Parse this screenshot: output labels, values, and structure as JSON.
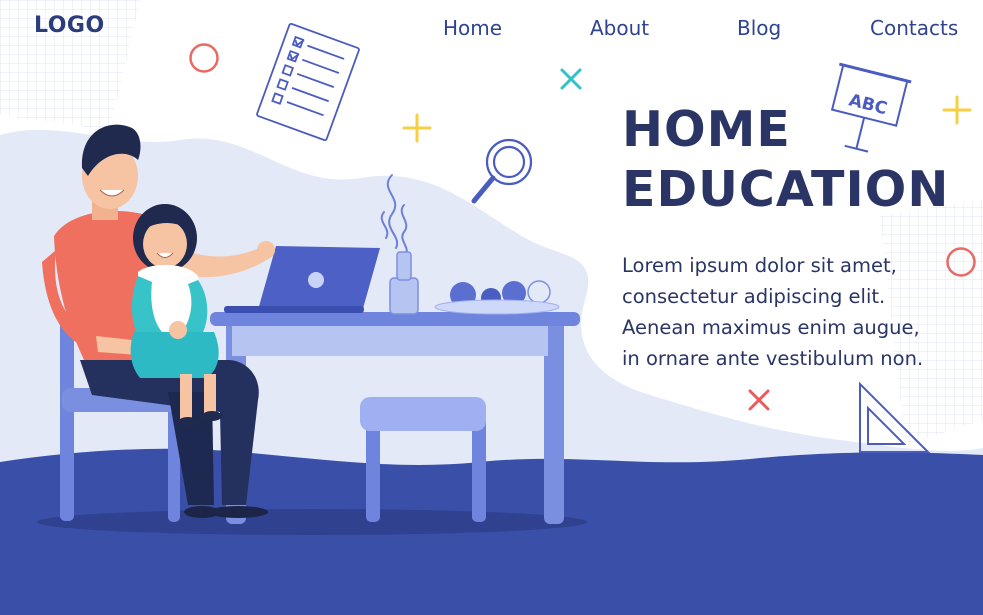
{
  "logo": {
    "text": "LOGO"
  },
  "nav": {
    "home": "Home",
    "about": "About",
    "blog": "Blog",
    "contacts": "Contacts"
  },
  "hero": {
    "title_line1": "HOME",
    "title_line2": "EDUCATION",
    "body_lines": [
      "Lorem ipsum dolor sit amet,",
      "consectetur adipiscing elit.",
      "Aenean maximus enim augue,",
      "in ornare ante vestibulum non."
    ]
  },
  "chalkboard": {
    "text": "ABC"
  },
  "colors": {
    "navy": "#2a3566",
    "floor": "#3a4fa8",
    "wave_light": "#e4e9f8",
    "furniture": "#7b8fe0",
    "shirt": "#f07060",
    "accent_yellow": "#f7cf45",
    "accent_teal": "#2fc2c8",
    "accent_red": "#e85c5c"
  }
}
